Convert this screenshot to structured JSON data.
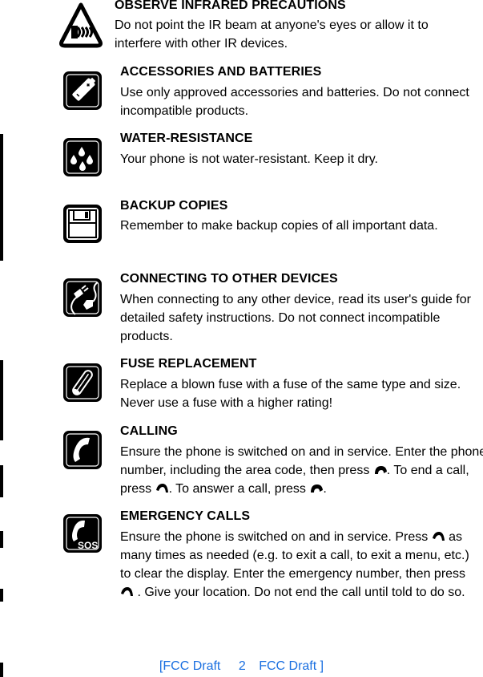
{
  "sections": [
    {
      "icon": "infrared-warning-icon",
      "title": "OBSERVE INFRARED PRECAUTIONS",
      "lines": [
        "Do not point the IR beam at anyone's eyes or allow it to",
        "interfere with other IR devices."
      ]
    },
    {
      "icon": "battery-icon",
      "title": "ACCESSORIES AND BATTERIES",
      "lines": [
        "Use only approved accessories and batteries. Do not connect",
        "incompatible products."
      ]
    },
    {
      "icon": "water-drops-icon",
      "title": "WATER-RESISTANCE",
      "lines": [
        "Your phone is not water-resistant. Keep it dry."
      ]
    },
    {
      "icon": "floppy-disk-icon",
      "title": "BACKUP COPIES",
      "lines": [
        "Remember to make backup copies of all important data."
      ]
    },
    {
      "icon": "plug-cable-icon",
      "title": "CONNECTING TO OTHER DEVICES",
      "lines": [
        "When connecting to any other device, read its user's guide for",
        "detailed safety instructions. Do not connect incompatible",
        "products."
      ]
    },
    {
      "icon": "fuse-icon",
      "title": "FUSE REPLACEMENT",
      "lines": [
        "Replace a blown fuse with a fuse of the same type and size.",
        "Never use a fuse with a higher rating!"
      ]
    },
    {
      "icon": "phone-handset-icon",
      "title": "CALLING",
      "line1": "Ensure the phone is switched on and in service. Enter the phone",
      "line2a": "number, including the area code, then press ",
      "line2b": ". To end a call,",
      "line3a": "press ",
      "line3b": ". To answer a call, press ",
      "line3c": "."
    },
    {
      "icon": "sos-phone-icon",
      "title": "EMERGENCY CALLS",
      "line1a": "Ensure the phone is switched on and in service. Press ",
      "line1b": " as",
      "line2": "many times as needed (e.g. to exit a call, to exit a menu, etc.)",
      "line3": "to clear the display. Enter the emergency number, then press",
      "line4b": " . Give your location. Do not end the call until told to do so."
    }
  ],
  "footer": {
    "left": "[FCC Draft",
    "page": "2",
    "right": "FCC Draft ]",
    "color": "#1a6fe0"
  }
}
